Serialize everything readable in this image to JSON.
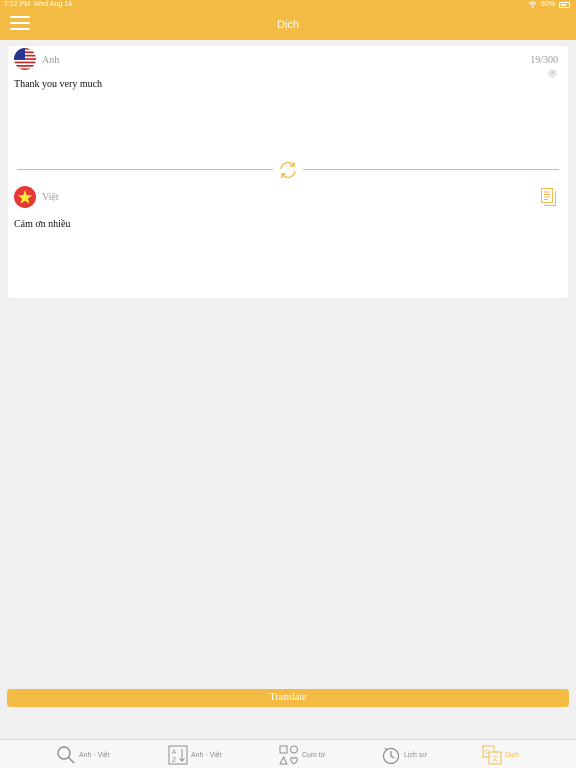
{
  "status_bar": {
    "time": "7:12 PM",
    "date": "Wed Aug 14",
    "battery": "60%"
  },
  "header": {
    "title": "Dịch"
  },
  "translator": {
    "source_lang": "Anh",
    "char_count": "19/300",
    "source_text": "Thank you very much",
    "target_lang": "Việt",
    "target_text": "Cám ơn nhiều"
  },
  "translate_button": "Translate",
  "tabs": [
    {
      "label": "Anh - Việt",
      "icon": "search-icon"
    },
    {
      "label": "Anh - Việt",
      "icon": "sort-az-icon"
    },
    {
      "label": "Cụm từ",
      "icon": "shapes-icon"
    },
    {
      "label": "Lịch sử",
      "icon": "clock-icon"
    },
    {
      "label": "Dịch",
      "icon": "translate-icon",
      "active": true
    }
  ],
  "colors": {
    "accent": "#f3bb44",
    "background": "#f0f0f0",
    "inactive": "#8e8e8e"
  }
}
